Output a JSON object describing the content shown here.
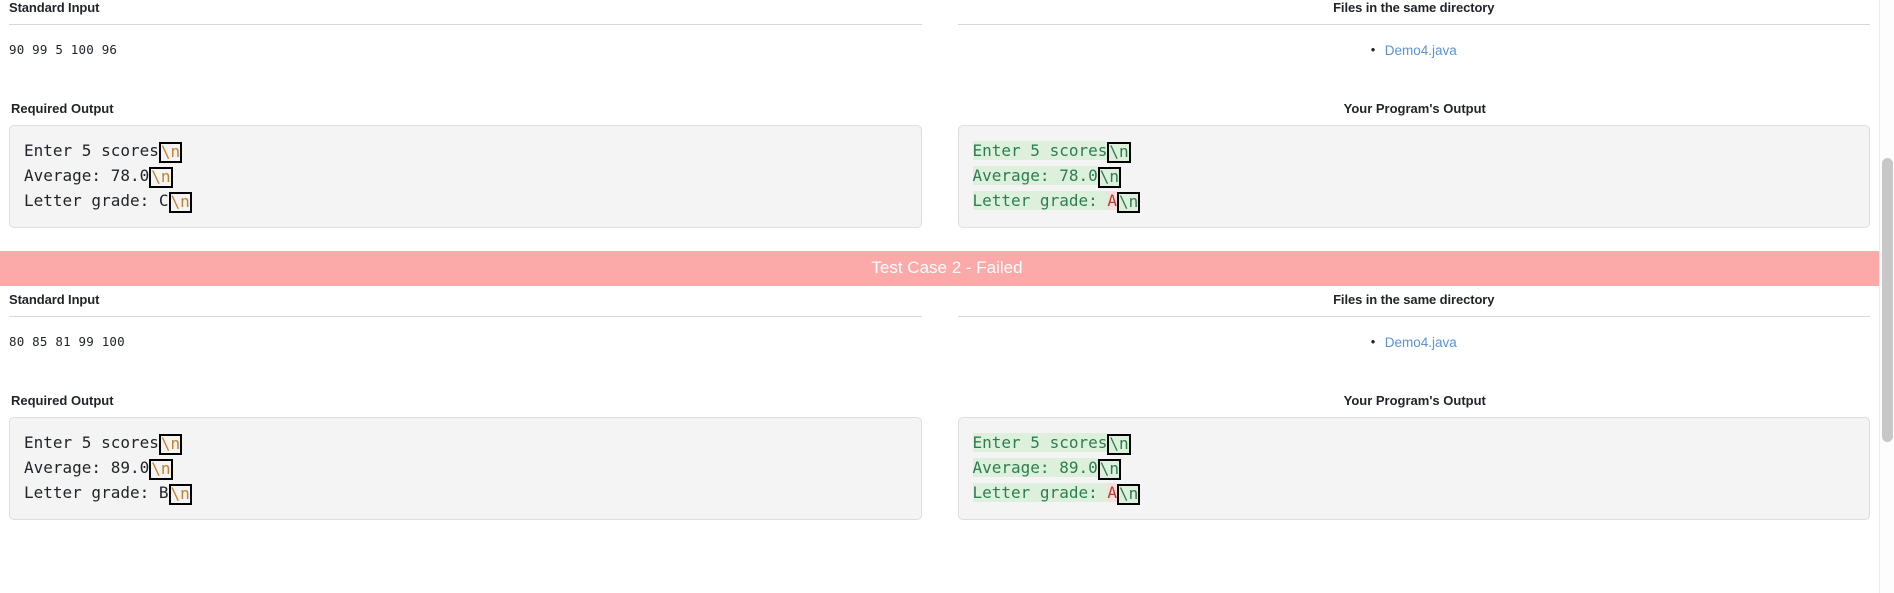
{
  "labels": {
    "standard_input": "Standard Input",
    "files_in_directory": "Files in the same directory",
    "required_output": "Required Output",
    "program_output": "Your Program's Output"
  },
  "colors": {
    "fail_banner_bg": "#fca9a9",
    "fail_banner_text": "#ffffff",
    "match_text": "#2e7d4f",
    "match_bg": "#dcf0dc",
    "mismatch_text": "#c0392b",
    "mismatch_bg": "#f9dede",
    "link": "#5b92d6",
    "box_bg": "#f4f4f4",
    "newline_token": "#c87f2a"
  },
  "newline_token": "\\n",
  "test_cases": [
    {
      "id": 1,
      "standard_input": "90 99 5 100 96",
      "files": [
        "Demo4.java"
      ],
      "required_output_lines": [
        {
          "text": "Enter 5 scores",
          "newline": true
        },
        {
          "text": "Average: 78.0",
          "newline": true
        },
        {
          "text": "Letter grade: C",
          "newline": true
        }
      ],
      "program_output_lines": [
        {
          "segments": [
            {
              "text": "Enter 5 scores",
              "match": true
            }
          ],
          "newline": true,
          "newline_match": true
        },
        {
          "segments": [
            {
              "text": "Average: 78.0",
              "match": true
            }
          ],
          "newline": true,
          "newline_match": true
        },
        {
          "segments": [
            {
              "text": "Letter grade: ",
              "match": true
            },
            {
              "text": "A",
              "match": false
            }
          ],
          "newline": true,
          "newline_match": true
        }
      ]
    },
    {
      "id": 2,
      "banner": "Test Case 2 - Failed",
      "status": "Failed",
      "standard_input": "80 85 81 99 100",
      "files": [
        "Demo4.java"
      ],
      "required_output_lines": [
        {
          "text": "Enter 5 scores",
          "newline": true
        },
        {
          "text": "Average: 89.0",
          "newline": true
        },
        {
          "text": "Letter grade: B",
          "newline": true
        }
      ],
      "program_output_lines": [
        {
          "segments": [
            {
              "text": "Enter 5 scores",
              "match": true
            }
          ],
          "newline": true,
          "newline_match": true
        },
        {
          "segments": [
            {
              "text": "Average: 89.0",
              "match": true
            }
          ],
          "newline": true,
          "newline_match": true
        },
        {
          "segments": [
            {
              "text": "Letter grade: ",
              "match": true
            },
            {
              "text": "A",
              "match": false
            }
          ],
          "newline": true,
          "newline_match": true
        }
      ]
    }
  ]
}
